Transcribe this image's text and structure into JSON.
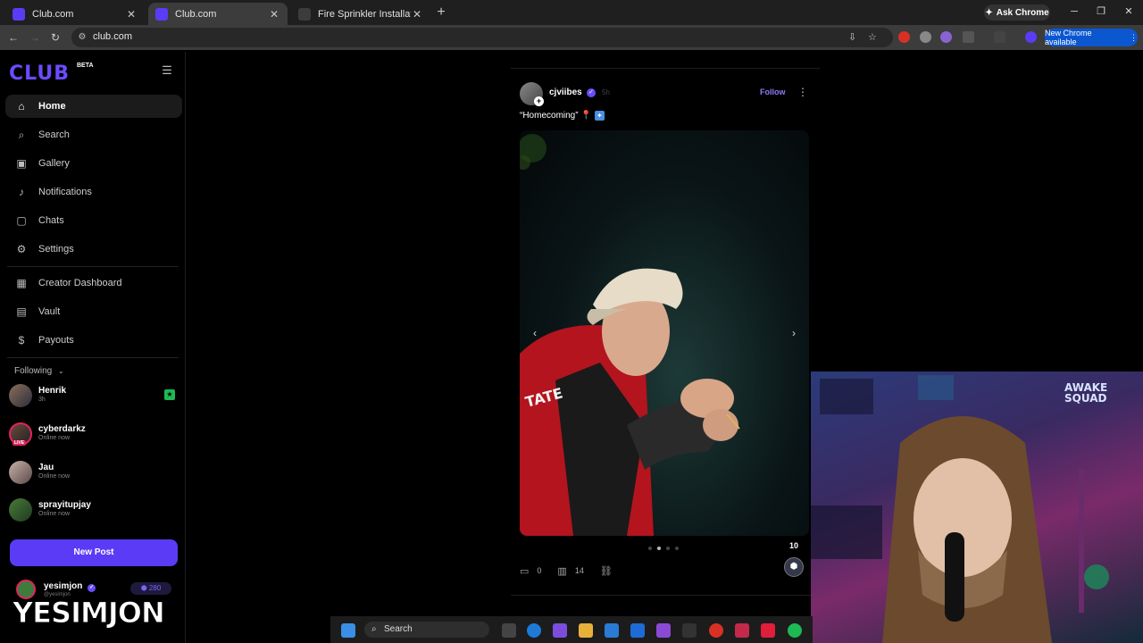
{
  "browser": {
    "tabs": [
      {
        "title": "Club.com",
        "active": false,
        "color": "#5b3bf5"
      },
      {
        "title": "Club.com",
        "active": true,
        "color": "#5b3bf5"
      },
      {
        "title": "Fire Sprinkler Installation, Fire A",
        "active": false,
        "color": "#3c3c3c"
      }
    ],
    "ask_chrome": "Ask Chrome",
    "url": "club.com",
    "new_chrome": "New Chrome available"
  },
  "sidebar": {
    "logo": "CLUB",
    "beta": "BETA",
    "nav": [
      {
        "label": "Home",
        "icon": "home-icon",
        "glyph": "⌂",
        "active": true
      },
      {
        "label": "Search",
        "icon": "search-icon",
        "glyph": "⌕",
        "active": false
      },
      {
        "label": "Gallery",
        "icon": "gallery-icon",
        "glyph": "▣",
        "active": false
      },
      {
        "label": "Notifications",
        "icon": "bell-icon",
        "glyph": "♪",
        "active": false
      },
      {
        "label": "Chats",
        "icon": "chat-icon",
        "glyph": "▢",
        "active": false
      },
      {
        "label": "Settings",
        "icon": "gear-icon",
        "glyph": "⚙",
        "active": false
      }
    ],
    "creator_nav": [
      {
        "label": "Creator Dashboard",
        "icon": "dashboard-icon",
        "glyph": "▦"
      },
      {
        "label": "Vault",
        "icon": "vault-icon",
        "glyph": "▤"
      },
      {
        "label": "Payouts",
        "icon": "payouts-icon",
        "glyph": "$"
      }
    ],
    "following_header": "Following",
    "following": [
      {
        "name": "Henrik",
        "status": "3h",
        "live": false,
        "star": true
      },
      {
        "name": "cyberdarkz",
        "status": "Online now",
        "live": true,
        "star": false
      },
      {
        "name": "Jau",
        "status": "Online now",
        "live": false,
        "star": false
      },
      {
        "name": "sprayitupjay",
        "status": "Online now",
        "live": false,
        "star": false
      }
    ],
    "live_label": "LIVE",
    "new_post": "New Post",
    "me": {
      "name": "yesimjon",
      "handle": "@yesimjon",
      "points": "280"
    }
  },
  "overlay_name": "YESIMJON",
  "post": {
    "author": "cjviibes",
    "time": "5h",
    "follow": "Follow",
    "caption": "“Homecoming”",
    "image_slides": 4,
    "active_slide": 2,
    "comments": "0",
    "views": "14",
    "tip_count": "10"
  },
  "webcam": {
    "neon_text": "AWAKE\nSQUAD"
  },
  "taskbar": {
    "search": "Search"
  }
}
